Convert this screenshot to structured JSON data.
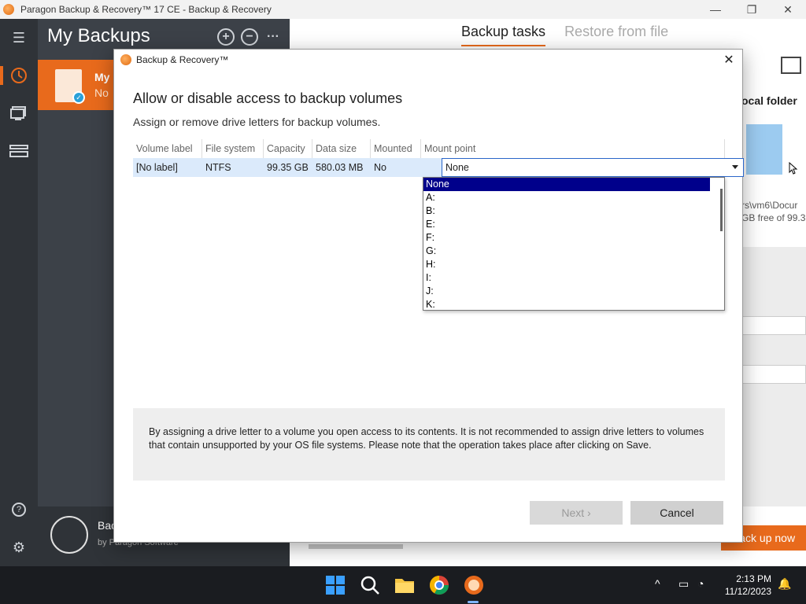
{
  "window": {
    "title": "Paragon Backup & Recovery™ 17 CE - Backup & Recovery",
    "min": "—",
    "max": "❐",
    "close": "✕"
  },
  "rail": {
    "menu_icon": "☰",
    "history_icon": "history-icon",
    "monitor_icon": "monitor-icon",
    "storage_icon": "storage-icon",
    "help_icon": "?",
    "settings_icon": "⚙"
  },
  "backups_panel": {
    "title": "My Backups",
    "add": "+",
    "remove": "−",
    "more": "···",
    "card_title": "My",
    "card_sub": "No",
    "footer_title": "Bac",
    "footer_sub": "by Paragon Software"
  },
  "main": {
    "tabs": [
      "Backup tasks",
      "Restore from file"
    ],
    "local_folder": "ocal folder",
    "path": "rs\\vm6\\Docur",
    "free": "GB free of 99.3",
    "misc_label": "o",
    "backup_now": "Back up now"
  },
  "dialog": {
    "title": "Backup & Recovery™",
    "heading": "Allow or disable access to backup volumes",
    "subheading": "Assign or remove drive letters for backup volumes.",
    "columns": [
      "Volume label",
      "File system",
      "Capacity",
      "Data size",
      "Mounted",
      "Mount point"
    ],
    "rows": [
      {
        "label": "[No label]",
        "fs": "NTFS",
        "capacity": "99.35 GB",
        "data": "580.03 MB",
        "mounted": "No",
        "mount_point": "None"
      }
    ],
    "dropdown_options": [
      "None",
      "A:",
      "B:",
      "E:",
      "F:",
      "G:",
      "H:",
      "I:",
      "J:",
      "K:"
    ],
    "selected_option": "None",
    "info": "By assigning a drive letter to a volume you open access to its contents. It is not recommended to assign drive letters to volumes that contain unsupported by your OS file systems. Please note that the operation takes place after clicking on Save.",
    "next_label": "Next ›",
    "cancel_label": "Cancel"
  },
  "taskbar": {
    "time": "2:13 PM",
    "date": "11/12/2023"
  },
  "colors": {
    "accent": "#e86a1c",
    "rail": "#2f3338",
    "panel": "#3c4148",
    "selection": "#00008b",
    "row_highlight": "#dbeafb"
  }
}
